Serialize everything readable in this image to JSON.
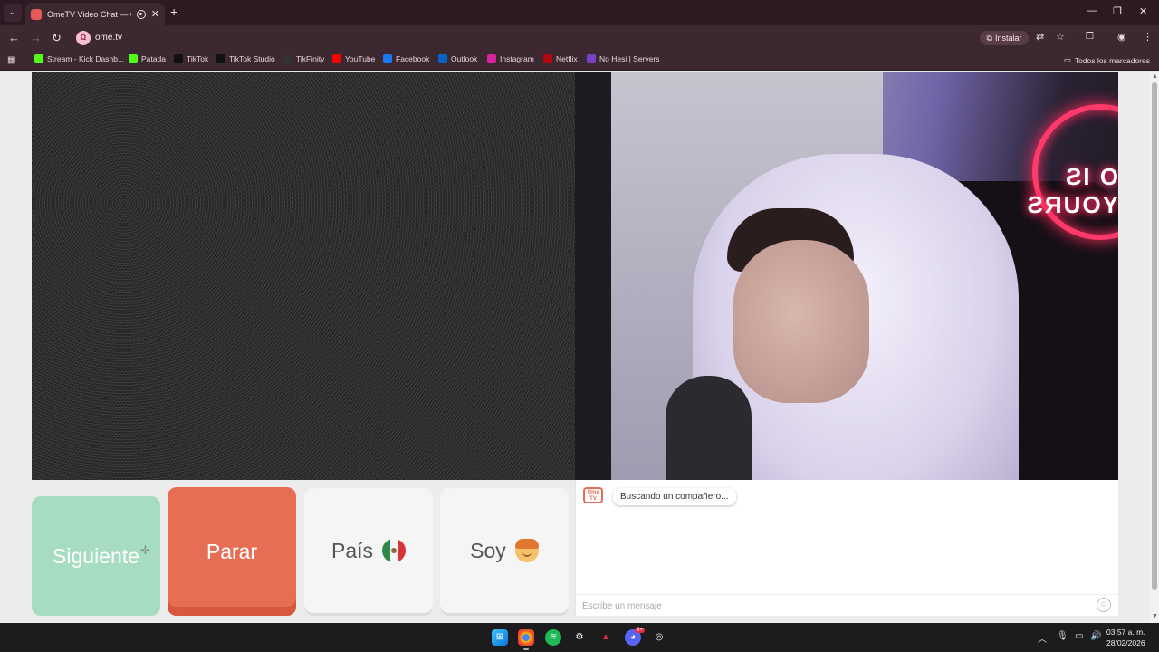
{
  "browser": {
    "tab_title": "OmeTV Video Chat — Ome",
    "url": "ome.tv",
    "install_label": "Instalar",
    "bookmarks": [
      {
        "label": "Stream - Kick Dashb...",
        "icon": "kick-icon",
        "color": "#53fc18"
      },
      {
        "label": "Patada",
        "icon": "kick-icon",
        "color": "#53fc18"
      },
      {
        "label": "TikTok",
        "icon": "tiktok-icon",
        "color": "#111111"
      },
      {
        "label": "TikTok Studio",
        "icon": "tiktok-icon",
        "color": "#111111"
      },
      {
        "label": "TikFinity",
        "icon": "tikfinity-icon",
        "color": "#333333"
      },
      {
        "label": "YouTube",
        "icon": "youtube-icon",
        "color": "#ff0000"
      },
      {
        "label": "Facebook",
        "icon": "facebook-icon",
        "color": "#1877f2"
      },
      {
        "label": "Outlook",
        "icon": "outlook-icon",
        "color": "#0a64c8"
      },
      {
        "label": "Instagram",
        "icon": "instagram-icon",
        "color": "#d6249f"
      },
      {
        "label": "Netflix",
        "icon": "netflix-icon",
        "color": "#b20710"
      },
      {
        "label": "No Hesi | Servers",
        "icon": "nohesi-icon",
        "color": "#7a3fc8"
      }
    ],
    "all_bookmarks_label": "Todos los marcadores"
  },
  "controls": {
    "next_label": "Siguiente",
    "stop_label": "Parar",
    "country_label": "País",
    "gender_label": "Soy"
  },
  "chat": {
    "logo_text": "Ome TV",
    "status_message": "Buscando un compañero...",
    "input_placeholder": "Escribe un mensaje"
  },
  "video": {
    "neon_text": "O IS YOURS"
  },
  "taskbar": {
    "time": "03:57 a. m.",
    "date": "28/02/2026",
    "discord_badge": "9+"
  },
  "colors": {
    "next": "#a6dcc0",
    "stop": "#e66e55",
    "chrome_frame": "#3c2830"
  }
}
